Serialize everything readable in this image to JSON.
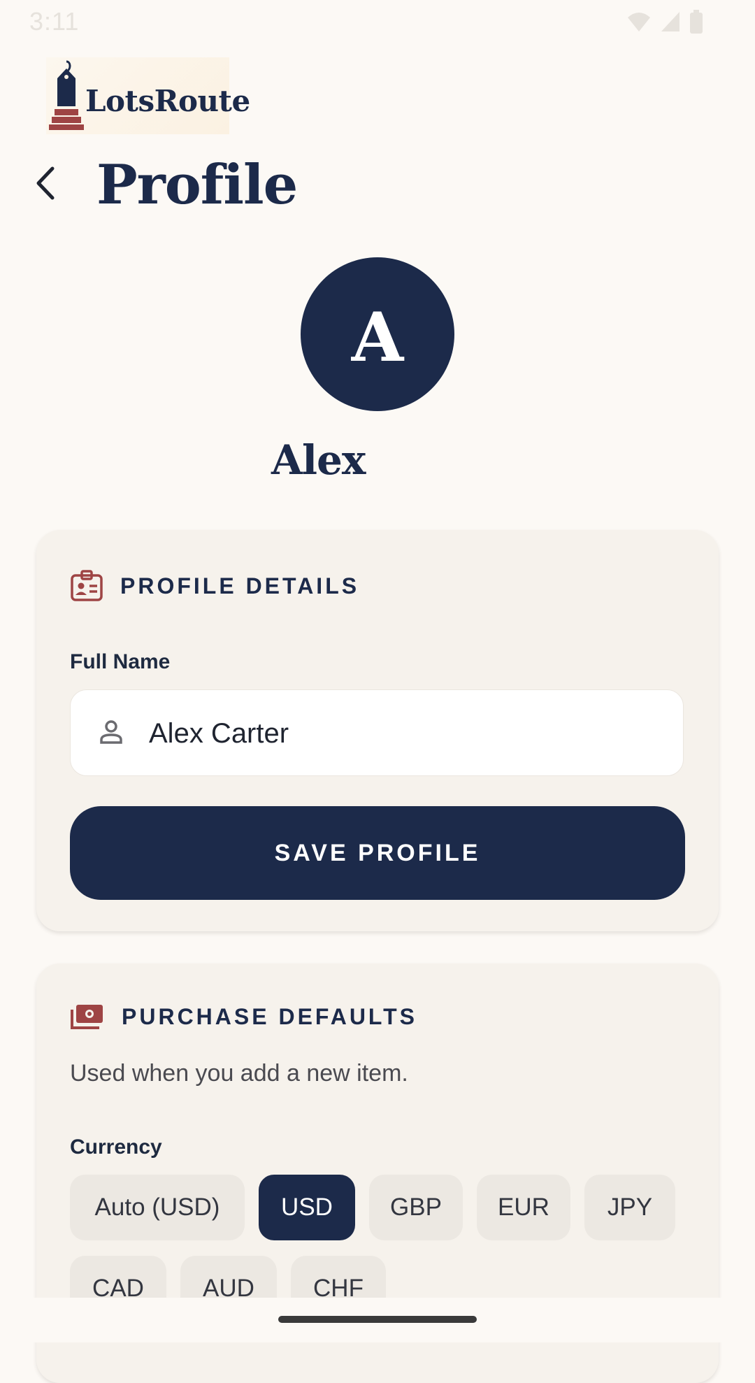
{
  "status_bar": {
    "time": "3:11"
  },
  "app": {
    "logo_text": "LotsRoute"
  },
  "header": {
    "title": "Profile"
  },
  "user": {
    "initial": "A",
    "display_name": "Alex"
  },
  "profile_details": {
    "title": "PROFILE DETAILS",
    "full_name_label": "Full Name",
    "full_name_value": "Alex Carter",
    "save_label": "SAVE PROFILE"
  },
  "purchase_defaults": {
    "title": "PURCHASE DEFAULTS",
    "subtitle": "Used when you add a new item.",
    "currency_label": "Currency",
    "currency_options": [
      "Auto (USD)",
      "USD",
      "GBP",
      "EUR",
      "JPY",
      "CAD",
      "AUD",
      "CHF"
    ],
    "selected_currency": "USD"
  },
  "colors": {
    "primary": "#1c2a4a",
    "accent": "#9e4444",
    "background": "#fcf9f5",
    "card": "#f6f2ec"
  },
  "icons": {
    "back": "chevron-left-icon",
    "profile_details": "id-card-icon",
    "full_name": "person-icon",
    "purchase_defaults": "money-icon"
  }
}
